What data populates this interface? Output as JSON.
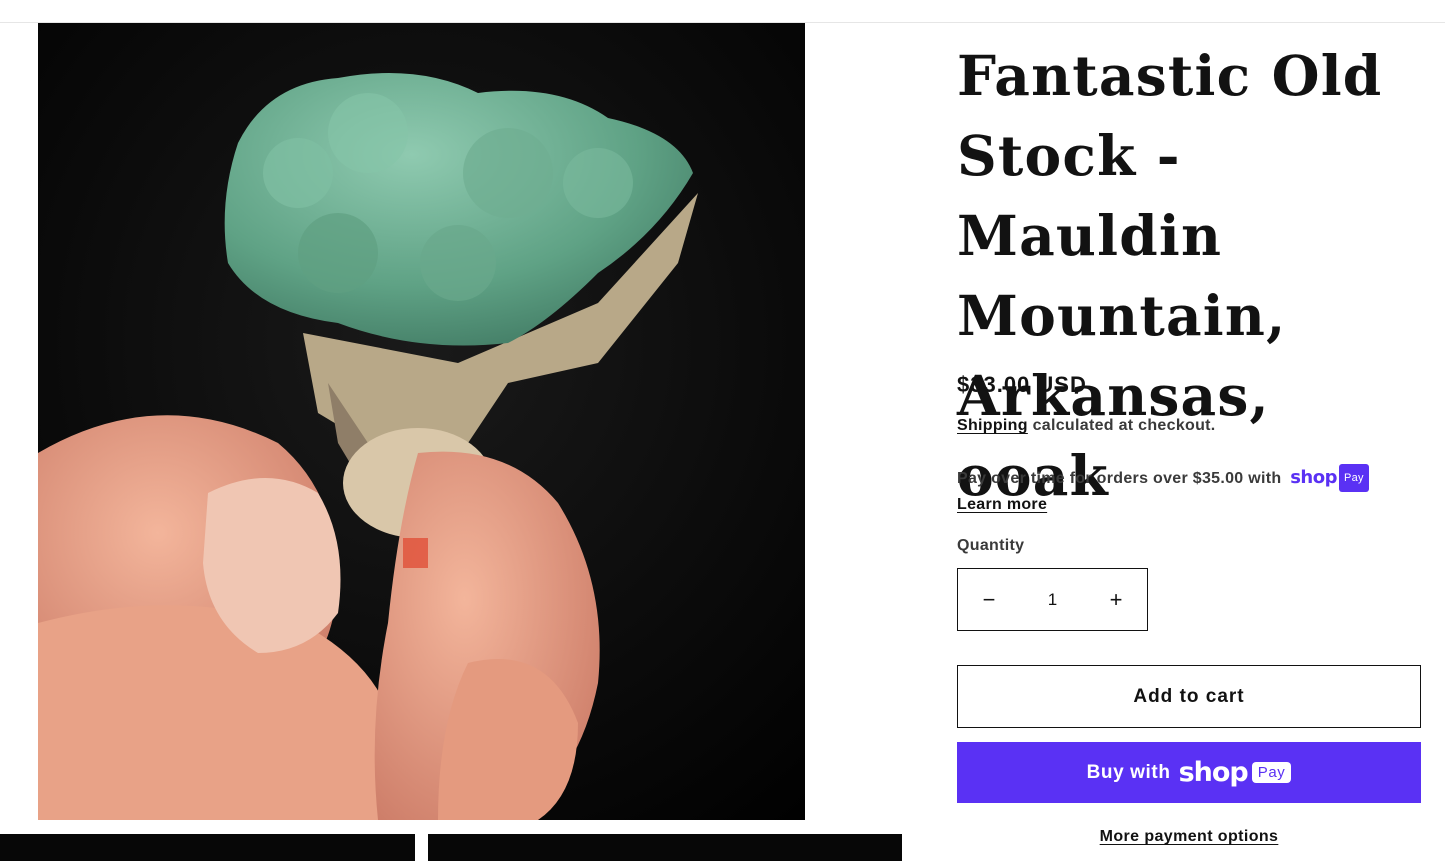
{
  "product": {
    "title": "Fantastic Old Stock - Mauldin Mountain, Arkansas, ooak",
    "price": "$33.00 USD",
    "shipping_link": "Shipping",
    "shipping_text": " calculated at checkout.",
    "installments_text": "Pay over time for orders over $35.00 with",
    "shoppay_wordmark": "shop",
    "shoppay_pill": "Pay",
    "learn_more": "Learn more"
  },
  "quantity": {
    "label": "Quantity",
    "value": "1",
    "decrease_symbol": "−",
    "increase_symbol": "+"
  },
  "buttons": {
    "add_to_cart": "Add to cart",
    "buy_with": "Buy with",
    "buy_wordmark": "shop",
    "buy_pill": "Pay",
    "more_payment": "More payment options"
  },
  "media": {
    "main_image": "green mineral specimen held between fingers on black background"
  },
  "colors": {
    "shoppay_purple": "#5a31f4",
    "text": "#121212"
  }
}
